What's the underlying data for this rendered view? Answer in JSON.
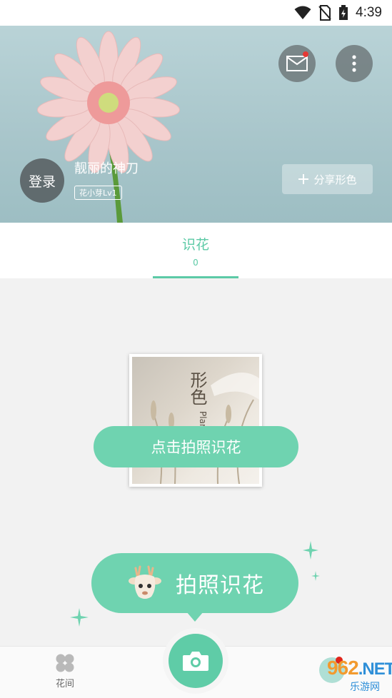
{
  "status_bar": {
    "time": "4:39",
    "icons": [
      "wifi-icon",
      "no-sim-icon",
      "battery-charging-icon"
    ]
  },
  "header": {
    "login_label": "登录",
    "username": "靓丽的神刀",
    "level_tag": "花小芽Lv1",
    "share_label": "分享形色",
    "mail_icon": "mail-icon",
    "more_icon": "more-vertical-icon",
    "mail_badge_color": "#e53935"
  },
  "tabs": [
    {
      "label": "识花",
      "count": "0",
      "active": true
    }
  ],
  "content": {
    "photo_overlay_text": "形色",
    "photo_overlay_latin": "Plan",
    "tap_to_identify": "点击拍照识花",
    "big_button_label": "拍照识花"
  },
  "bottom_nav": {
    "home_label": "花间",
    "home_icon": "clover-icon",
    "camera_icon": "camera-icon"
  },
  "watermark": {
    "text_main": "962",
    "text_net": ".NET",
    "text_sub": "乐游网"
  },
  "colors": {
    "accent": "#5ccaa6",
    "pill": "#6fd3b0",
    "hero_bg": "#a9c6cb"
  }
}
